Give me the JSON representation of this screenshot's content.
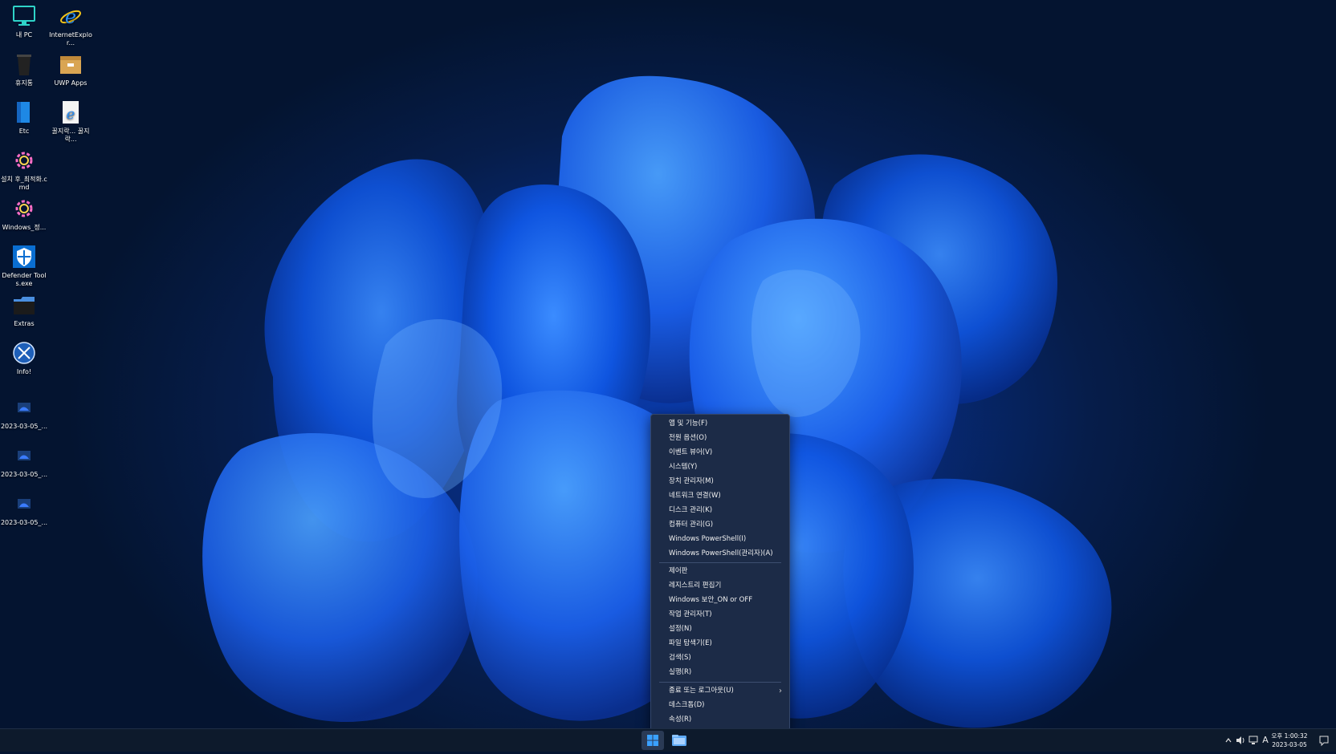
{
  "desktop": {
    "icons": [
      {
        "label": "내 PC",
        "icon": "monitor-icon"
      },
      {
        "label": "InternetExplor...",
        "icon": "internet-explorer-icon"
      },
      {
        "label": "휴지통",
        "icon": "recycle-bin-icon"
      },
      {
        "label": "UWP Apps",
        "icon": "folder-box-icon"
      },
      {
        "label": "Etc",
        "icon": "blue-folder-icon"
      },
      {
        "label": "꿀지락... 꿀지락...",
        "icon": "html-file-icon"
      },
      {
        "label": "설치 후_최적화.cmd",
        "icon": "gear-icon"
      },
      {
        "label": "Windows_정...",
        "icon": "gear-icon"
      },
      {
        "label": "Defender Tools.exe",
        "icon": "shield-icon"
      },
      {
        "label": "Extras",
        "icon": "black-folder-icon"
      },
      {
        "label": "Info!",
        "icon": "globe-icon"
      },
      {
        "label": "2023-03-05_...",
        "icon": "screenshot-file-icon"
      },
      {
        "label": "2023-03-05_...",
        "icon": "screenshot-file-icon"
      },
      {
        "label": "2023-03-05_...",
        "icon": "screenshot-file-icon"
      }
    ]
  },
  "context_menu": {
    "group1": [
      "앱 및 기능(F)",
      "전원 옵션(O)",
      "이벤트 뷰어(V)",
      "시스템(Y)",
      "장치 관리자(M)",
      "네트워크 연결(W)",
      "디스크 관리(K)",
      "컴퓨터 관리(G)",
      "Windows PowerShell(I)",
      "Windows PowerShell(관리자)(A)"
    ],
    "group2": [
      "제어판",
      "레지스트리 편집기",
      "Windows 보안_ON or OFF",
      "작업 관리자(T)",
      "설정(N)",
      "파일 탐색기(E)",
      "검색(S)",
      "실행(R)"
    ],
    "group3": [
      "종료 또는 로그아웃(U)",
      "데스크톱(D)",
      "속성(R)"
    ]
  },
  "taskbar": {
    "start_icon": "windows-logo-icon",
    "explorer_icon": "file-explorer-icon",
    "ime_indicator": "A",
    "time": "오후 1:00:32",
    "date": "2023-03-05"
  },
  "colors": {
    "menu_bg": "#1c2b47",
    "taskbar_bg": "#0d1a2c",
    "accent": "#1a6fd6"
  }
}
